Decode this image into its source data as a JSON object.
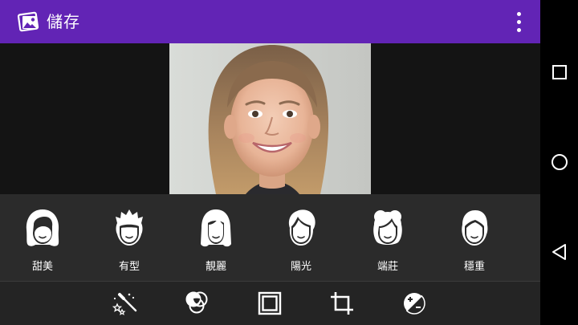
{
  "app_bar": {
    "title": "儲存",
    "app_icon": "photos-icon",
    "menu_icon": "more-vert-icon",
    "background": "#6224b5"
  },
  "photo": {
    "subject": "portrait-photo"
  },
  "style_presets": [
    {
      "label": "甜美",
      "icon": "face-woman-bob-icon"
    },
    {
      "label": "有型",
      "icon": "face-man-spiky-icon"
    },
    {
      "label": "靚麗",
      "icon": "face-woman-long-icon"
    },
    {
      "label": "陽光",
      "icon": "face-man-tousled-icon"
    },
    {
      "label": "端莊",
      "icon": "face-woman-updo-icon"
    },
    {
      "label": "穩重",
      "icon": "face-man-classic-icon"
    }
  ],
  "toolbar": [
    {
      "icon": "magic-wand-icon"
    },
    {
      "icon": "color-filter-icon"
    },
    {
      "icon": "frame-icon"
    },
    {
      "icon": "crop-icon"
    },
    {
      "icon": "exposure-icon"
    }
  ],
  "nav_bar": [
    {
      "icon": "recents-icon"
    },
    {
      "icon": "home-icon"
    },
    {
      "icon": "back-icon"
    }
  ]
}
